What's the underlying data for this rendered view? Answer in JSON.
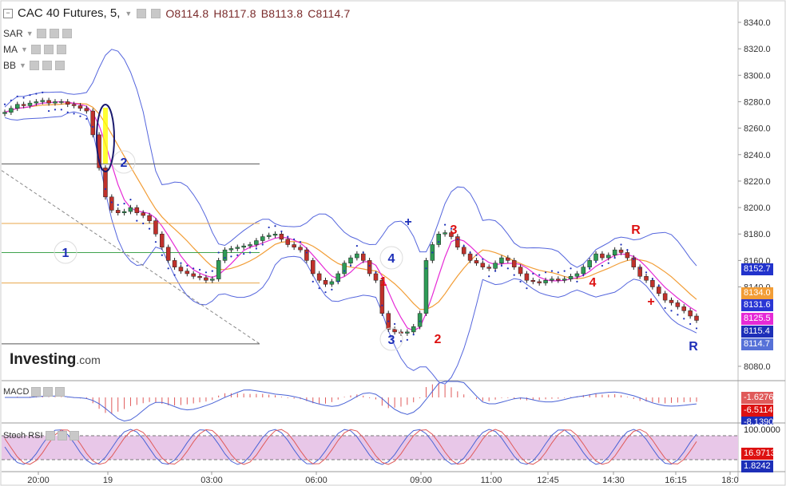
{
  "header": {
    "title": "CAC 40 Futures, 5,",
    "open": "O8114.8",
    "high": "H8117.8",
    "low": "B8113.8",
    "close": "C8114.7"
  },
  "indicators": [
    {
      "label": "SAR"
    },
    {
      "label": "MA"
    },
    {
      "label": "BB"
    }
  ],
  "logo": {
    "brand": "Investing",
    "suffix": ".com"
  },
  "chart_data": [
    {
      "type": "candlestick",
      "ylim": [
        8060,
        8350
      ],
      "y_ticks": [
        "8340.0",
        "8320.0",
        "8300.0",
        "8280.0",
        "8260.0",
        "8240.0",
        "8220.0",
        "8200.0",
        "8180.0",
        "8160.0",
        "8140.0",
        "8080.0"
      ],
      "x_ticks": [
        "20:00",
        "19",
        "03:00",
        "06:00",
        "09:00",
        "11:00",
        "12:45",
        "14:30",
        "16:15",
        "18:0"
      ],
      "price_tags": [
        {
          "value": "8152.7",
          "color": "#2233cc"
        },
        {
          "value": "8134.0",
          "color": "#f29d36"
        },
        {
          "value": "8131.6",
          "color": "#2a36d4"
        },
        {
          "value": "8125.5",
          "color": "#e62ad6"
        },
        {
          "value": "8115.4",
          "color": "#1d2fb8"
        },
        {
          "value": "8114.7",
          "color": "#5671d8"
        }
      ],
      "annotations": [
        "1",
        "2",
        "3",
        "4",
        "1",
        "2",
        "3",
        "4",
        "+",
        "+",
        "R",
        "R"
      ],
      "close": [
        8272,
        8275,
        8278,
        8277,
        8279,
        8280,
        8281,
        8279,
        8280,
        8280,
        8278,
        8277,
        8275,
        8273,
        8255,
        8230,
        8208,
        8198,
        8196,
        8197,
        8200,
        8196,
        8194,
        8190,
        8180,
        8170,
        8160,
        8155,
        8152,
        8150,
        8148,
        8147,
        8145,
        8146,
        8160,
        8168,
        8169,
        8170,
        8171,
        8172,
        8175,
        8178,
        8179,
        8180,
        8176,
        8172,
        8170,
        8168,
        8160,
        8150,
        8145,
        8142,
        8144,
        8150,
        8158,
        8162,
        8165,
        8160,
        8150,
        8145,
        8120,
        8108,
        8106,
        8105,
        8106,
        8110,
        8120,
        8160,
        8172,
        8180,
        8181,
        8178,
        8170,
        8165,
        8160,
        8158,
        8155,
        8154,
        8158,
        8162,
        8160,
        8155,
        8150,
        8145,
        8144,
        8143,
        8145,
        8146,
        8145,
        8146,
        8148,
        8150,
        8155,
        8160,
        8165,
        8162,
        8164,
        8168,
        8166,
        8162,
        8155,
        8148,
        8145,
        8140,
        8135,
        8130,
        8128,
        8125,
        8122,
        8118,
        8114.7
      ]
    },
    {
      "type": "line",
      "title": "MACD",
      "values": [
        "-1.6276",
        "-6.5114",
        "-8.1390"
      ]
    },
    {
      "type": "line",
      "title": "Stoch RSI",
      "values": [
        "100.0000",
        "16.9713",
        "1.8242"
      ]
    }
  ]
}
